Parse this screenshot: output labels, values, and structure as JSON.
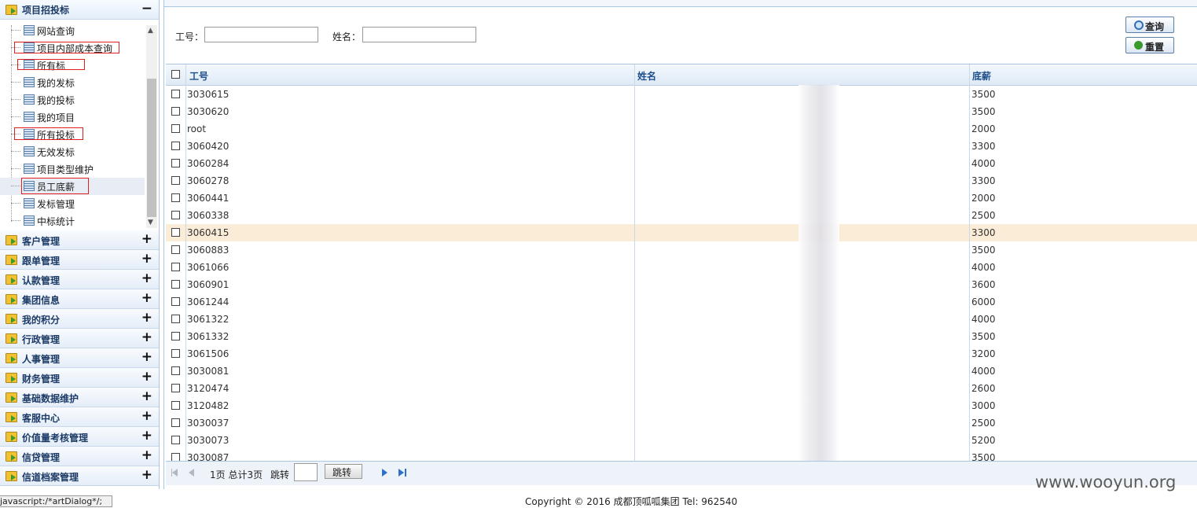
{
  "sidebar": {
    "open_panel": "项目招投标",
    "open_panel_toggle": "−",
    "tree_items": [
      {
        "label": "网站查询"
      },
      {
        "label": "项目内部成本查询"
      },
      {
        "label": "所有标"
      },
      {
        "label": "我的发标"
      },
      {
        "label": "我的投标"
      },
      {
        "label": "我的项目"
      },
      {
        "label": "所有投标"
      },
      {
        "label": "无效发标"
      },
      {
        "label": "项目类型维护"
      },
      {
        "label": "员工底薪"
      },
      {
        "label": "发标管理"
      },
      {
        "label": "中标统计"
      }
    ],
    "menus": [
      {
        "label": "客户管理",
        "toggle": "+"
      },
      {
        "label": "跟单管理",
        "toggle": "+"
      },
      {
        "label": "认款管理",
        "toggle": "+"
      },
      {
        "label": "集团信息",
        "toggle": "+"
      },
      {
        "label": "我的积分",
        "toggle": "+"
      },
      {
        "label": "行政管理",
        "toggle": "+"
      },
      {
        "label": "人事管理",
        "toggle": "+"
      },
      {
        "label": "财务管理",
        "toggle": "+"
      },
      {
        "label": "基础数据维护",
        "toggle": "+"
      },
      {
        "label": "客服中心",
        "toggle": "+"
      },
      {
        "label": "价值量考核管理",
        "toggle": "+"
      },
      {
        "label": "信贷管理",
        "toggle": "+"
      },
      {
        "label": "信道档案管理",
        "toggle": "+"
      }
    ]
  },
  "search": {
    "id_label": "工号：",
    "name_label": "姓名：",
    "id_value": "",
    "name_value": "",
    "query_button": "查询",
    "reset_button": "重置"
  },
  "table": {
    "columns": [
      "工号",
      "姓名",
      "底薪"
    ],
    "rows": [
      {
        "id": "3030615",
        "salary": "3500"
      },
      {
        "id": "3030620",
        "salary": "3500"
      },
      {
        "id": "root",
        "salary": "2000"
      },
      {
        "id": "3060420",
        "salary": "3300"
      },
      {
        "id": "3060284",
        "salary": "4000"
      },
      {
        "id": "3060278",
        "salary": "3300"
      },
      {
        "id": "3060441",
        "salary": "2000"
      },
      {
        "id": "3060338",
        "salary": "2500"
      },
      {
        "id": "3060415",
        "salary": "3300"
      },
      {
        "id": "3060883",
        "salary": "3500"
      },
      {
        "id": "3061066",
        "salary": "4000"
      },
      {
        "id": "3060901",
        "salary": "3600"
      },
      {
        "id": "3061244",
        "salary": "6000"
      },
      {
        "id": "3061322",
        "salary": "4000"
      },
      {
        "id": "3061332",
        "salary": "3500"
      },
      {
        "id": "3061506",
        "salary": "3200"
      },
      {
        "id": "3030081",
        "salary": "4000"
      },
      {
        "id": "3120474",
        "salary": "2600"
      },
      {
        "id": "3120482",
        "salary": "3000"
      },
      {
        "id": "3030037",
        "salary": "2500"
      },
      {
        "id": "3030073",
        "salary": "5200"
      },
      {
        "id": "3030087",
        "salary": "3500"
      }
    ]
  },
  "pager": {
    "page_info": "1页 总计3页",
    "jump_label": "跳转",
    "jump_value": "",
    "jump_button": "跳转"
  },
  "statusbar": "javascript:/*artDialog*/;",
  "footer": "Copyright © 2016 成都顶呱呱集团 Tel: 962540",
  "watermark": "www.wooyun.org",
  "colors": {
    "accent": "#1d4f8c",
    "highlight_row": "#fbecd7",
    "annotation_box": "#e02020"
  }
}
